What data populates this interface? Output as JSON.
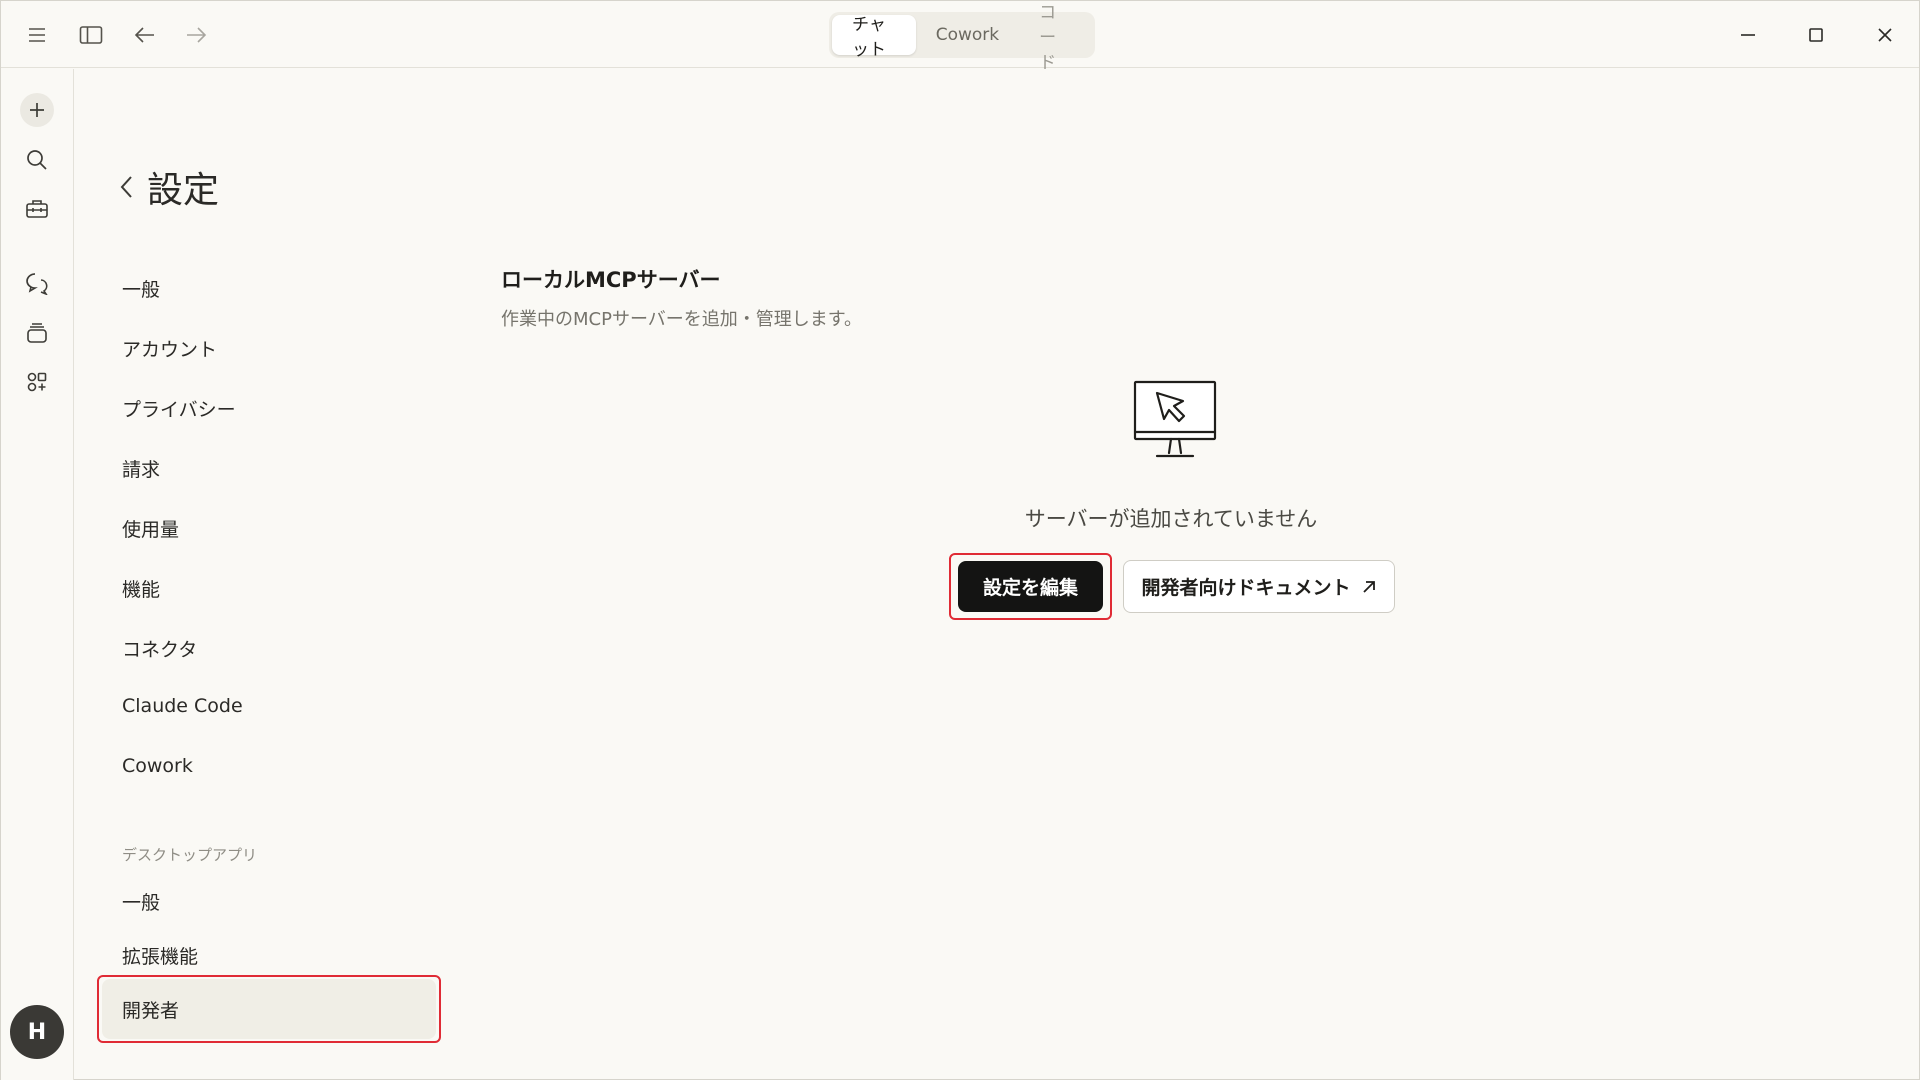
{
  "titlebar": {
    "icons": [
      "hamburger-menu-icon",
      "sidebar-toggle-icon",
      "back-arrow-icon",
      "forward-arrow-icon"
    ],
    "mode_tabs": [
      {
        "label": "チャット",
        "active": true
      },
      {
        "label": "Cowork",
        "active": false
      },
      {
        "label": "コード",
        "active": false
      }
    ],
    "window_controls": [
      "minimize-icon",
      "maximize-icon",
      "close-icon"
    ]
  },
  "rail": {
    "icons": [
      "plus-icon",
      "search-icon",
      "briefcase-icon",
      "chat-bubbles-icon",
      "stack-icon",
      "apps-icon"
    ],
    "avatar_initial": "H"
  },
  "settings": {
    "title": "設定",
    "nav_items": [
      "一般",
      "アカウント",
      "プライバシー",
      "請求",
      "使用量",
      "機能",
      "コネクタ",
      "Claude Code",
      "Cowork"
    ],
    "desktop_section_label": "デスクトップアプリ",
    "desktop_items": [
      "一般",
      "拡張機能",
      "開発者"
    ],
    "selected_item": "開発者"
  },
  "main": {
    "section_title": "ローカルMCPサーバー",
    "section_description": "作業中のMCPサーバーを追加・管理します。",
    "empty_state_icon": "monitor-cursor-icon",
    "empty_message": "サーバーが追加されていません",
    "primary_button": "設定を編集",
    "secondary_button": "開発者向けドキュメント"
  },
  "colors": {
    "background": "#faf9f5",
    "primary_button": "#141413",
    "highlight_red": "#e02b35"
  }
}
